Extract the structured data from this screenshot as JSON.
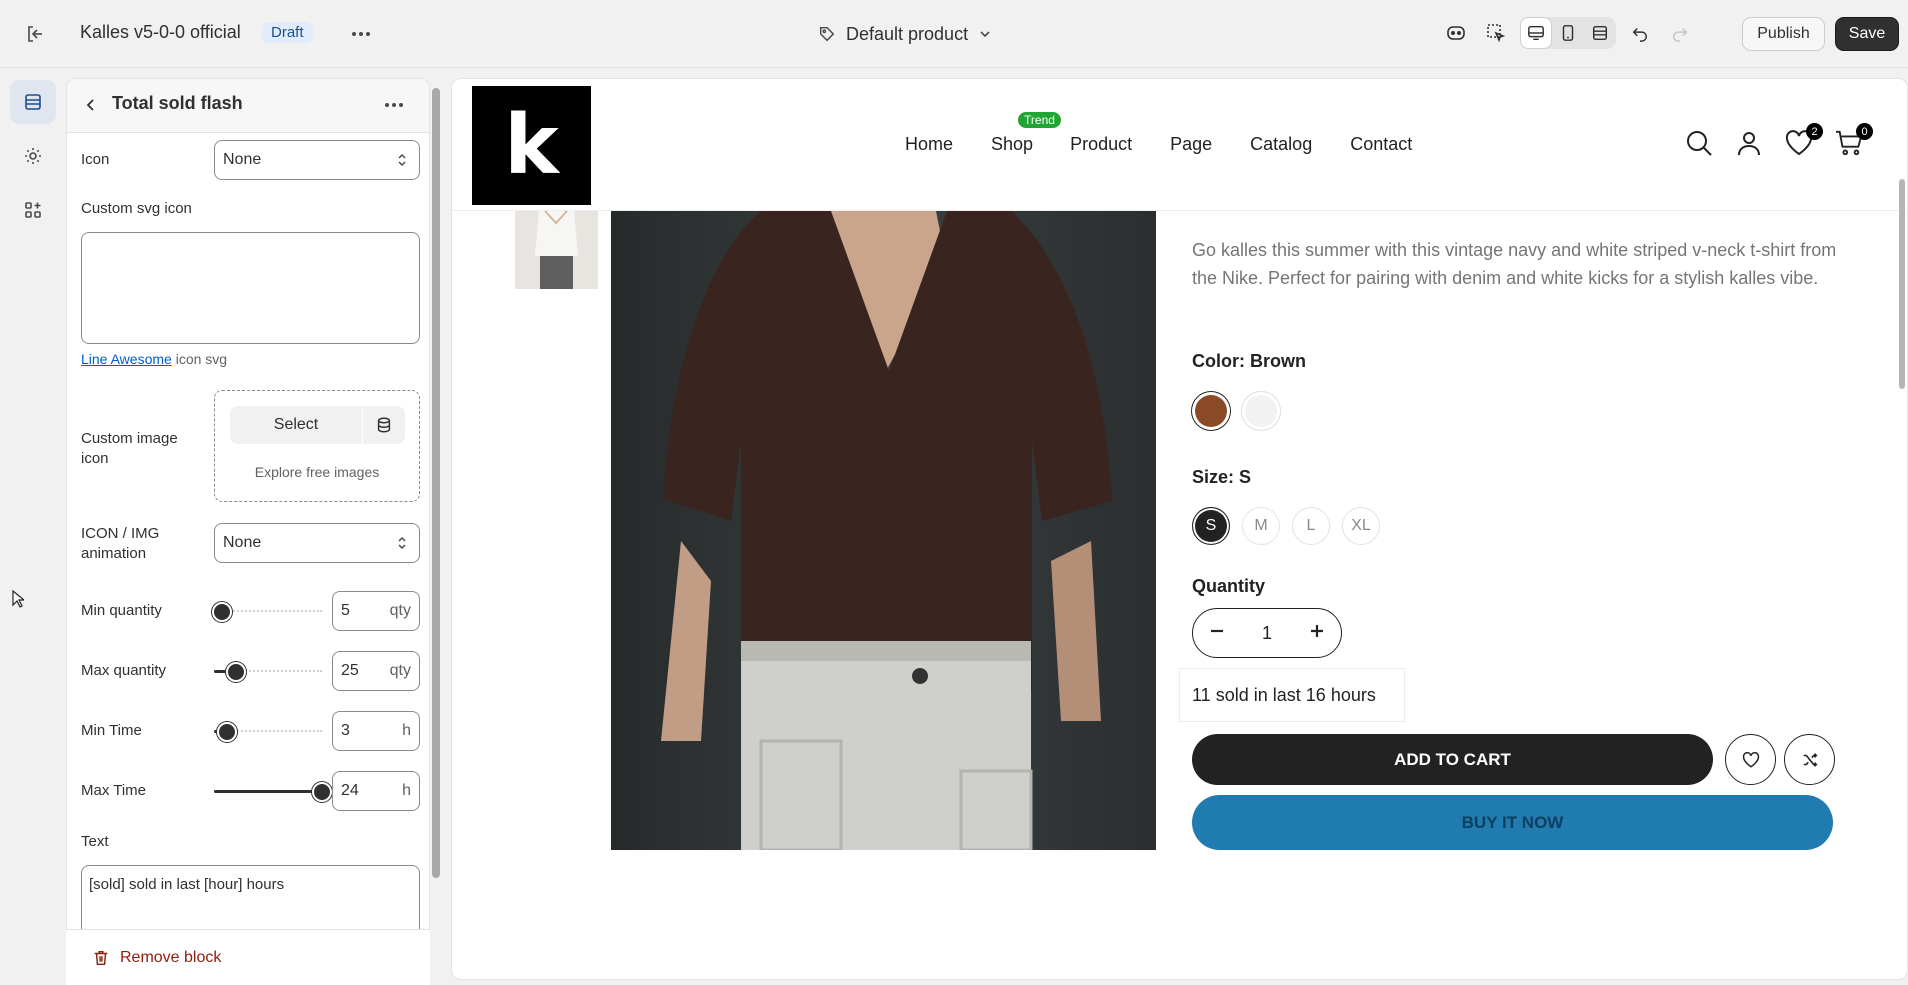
{
  "topbar": {
    "theme_name": "Kalles v5-0-0 official",
    "status_badge": "Draft",
    "template_label": "Default product",
    "publish_label": "Publish",
    "save_label": "Save"
  },
  "panel": {
    "title": "Total sold flash",
    "icon_label": "Icon",
    "icon_value": "None",
    "custom_svg_label": "Custom svg icon",
    "custom_svg_value": "",
    "help_link": "Line Awesome",
    "help_suffix": "icon svg",
    "custom_image_label": "Custom image icon",
    "select_label": "Select",
    "explore_label": "Explore free images",
    "animation_label": "ICON / IMG animation",
    "animation_value": "None",
    "ranges": [
      {
        "label": "Min quantity",
        "value": "5",
        "unit": "qty",
        "fraction": 0.07
      },
      {
        "label": "Max quantity",
        "value": "25",
        "unit": "qty",
        "fraction": 0.2
      },
      {
        "label": "Min Time",
        "value": "3",
        "unit": "h",
        "fraction": 0.12
      },
      {
        "label": "Max Time",
        "value": "24",
        "unit": "h",
        "fraction": 1.0
      }
    ],
    "text_label": "Text",
    "text_value": "[sold] sold in last [hour] hours",
    "remove_label": "Remove block"
  },
  "store": {
    "logo": "k",
    "nav": [
      "Home",
      "Shop",
      "Product",
      "Page",
      "Catalog",
      "Contact"
    ],
    "trend_badge": "Trend",
    "wishlist_count": "2",
    "cart_count": "0",
    "description": "Go kalles this summer with this vintage navy and white striped v-neck t-shirt from the Nike. Perfect for pairing with denim and white kicks for a stylish kalles vibe.",
    "color_label": "Color: Brown",
    "colors": [
      "#8b4a26",
      "#f2f2f2"
    ],
    "size_label": "Size: S",
    "sizes": [
      "S",
      "M",
      "L",
      "XL"
    ],
    "quantity_label": "Quantity",
    "quantity_value": "1",
    "sold_flash": {
      "count": "11",
      "hours": "16",
      "pre": "sold in last",
      "post": "hours"
    },
    "add_to_cart": "ADD TO CART",
    "buy_now": "BUY IT NOW"
  }
}
